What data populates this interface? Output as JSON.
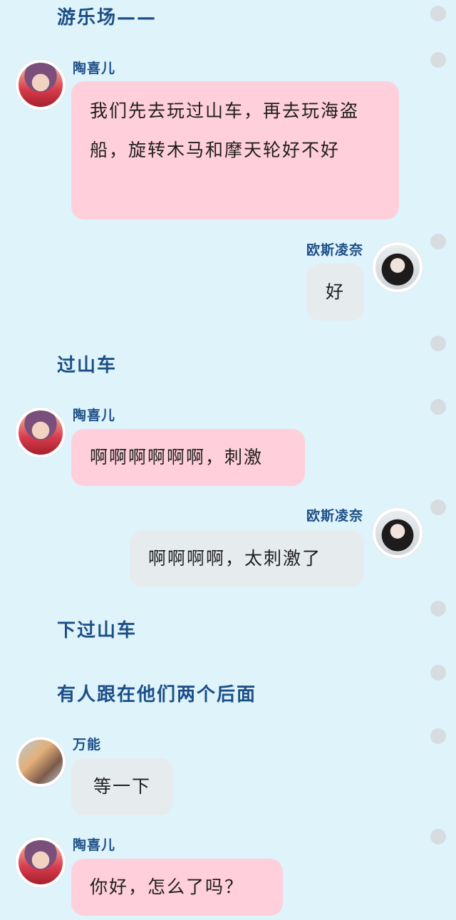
{
  "narrations": {
    "amusement_park": "游乐场——",
    "roller_coaster": "过山车",
    "get_off": "下过山车",
    "followed": "有人跟在他们两个后面"
  },
  "speakers": {
    "tao": "陶喜儿",
    "ousi": "欧斯凌奈",
    "wanneng": "万能"
  },
  "messages": {
    "m1": "我们先去玩过山车，再去玩海盗船，旋转木马和摩天轮好不好",
    "m2": "好",
    "m3": "啊啊啊啊啊啊，刺激",
    "m4": "啊啊啊啊，太刺激了",
    "m5": "等一下",
    "m6": "你好，怎么了吗？"
  },
  "colors": {
    "background": "#dff3fb",
    "narration_text": "#1c4f86",
    "pink_bubble": "#ffcfdb",
    "gray_bubble": "#e6ebee"
  }
}
